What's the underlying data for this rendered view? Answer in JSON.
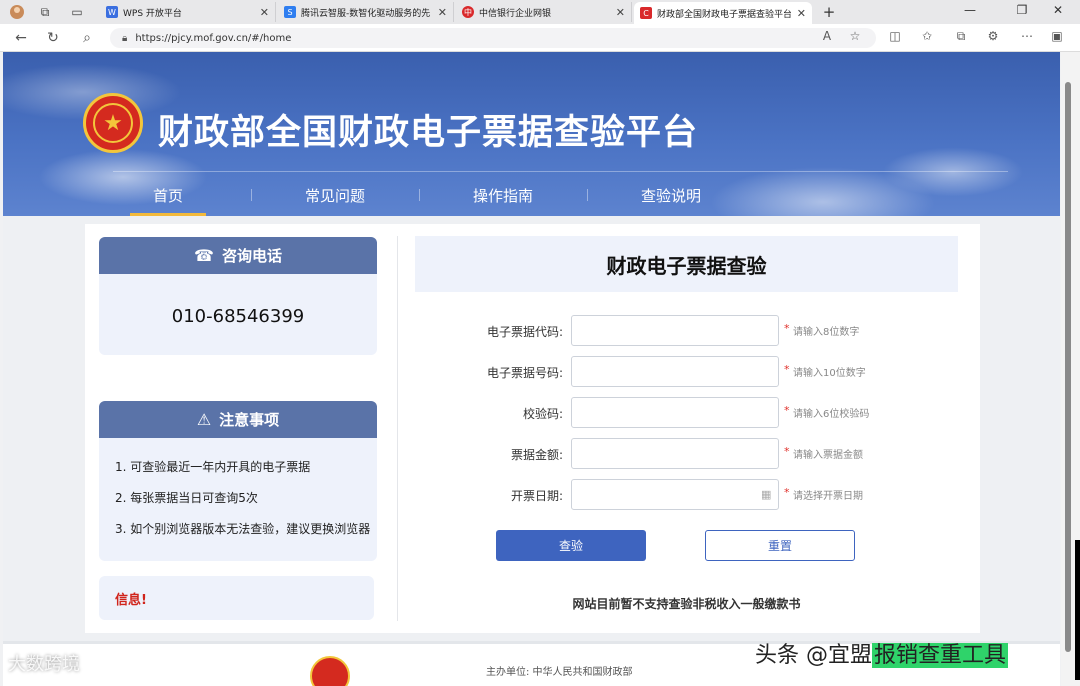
{
  "browser": {
    "tabs": [
      {
        "title": "WPS 开放平台",
        "color": "#3b6fe0",
        "glyph": "W"
      },
      {
        "title": "腾讯云智服-数智化驱动服务的先",
        "color": "#2f7ef0",
        "glyph": "S"
      },
      {
        "title": "中信银行企业网银",
        "color": "#d9292b",
        "glyph": "中"
      },
      {
        "title": "财政部全国财政电子票据查验平台",
        "color": "#d9292b",
        "glyph": "C",
        "active": true
      }
    ],
    "url": "https://pjcy.mof.gov.cn/#/home",
    "icons": [
      "back-icon",
      "refresh-icon",
      "search-icon",
      "lock-icon",
      "read-aloud-icon",
      "favorite-icon",
      "split-icon",
      "favorites-icon",
      "collections-icon",
      "extensions-icon",
      "more-icon",
      "sidebar-icon"
    ]
  },
  "site": {
    "title": "财政部全国财政电子票据查验平台",
    "nav": [
      {
        "label": "首页",
        "active": true
      },
      {
        "label": "常见问题"
      },
      {
        "label": "操作指南"
      },
      {
        "label": "查验说明"
      }
    ]
  },
  "consult": {
    "heading": "咨询电话",
    "phone": "010-68546399"
  },
  "notice": {
    "heading": "注意事项",
    "items": [
      "1. 可查验最近一年内开具的电子票据",
      "2. 每张票据当日可查询5次",
      "3. 如个别浏览器版本无法查验，建议更换浏览器"
    ]
  },
  "info": {
    "label": "信息!"
  },
  "form": {
    "title": "财政电子票据查验",
    "fields": [
      {
        "label": "电子票据代码:",
        "hint": "请输入8位数字",
        "value": ""
      },
      {
        "label": "电子票据号码:",
        "hint": "请输入10位数字",
        "value": ""
      },
      {
        "label": "校验码:",
        "hint": "请输入6位校验码",
        "value": ""
      },
      {
        "label": "票据金额:",
        "hint": "请输入票据金额",
        "value": ""
      },
      {
        "label": "开票日期:",
        "hint": "请选择开票日期",
        "value": ""
      }
    ],
    "required_mark": "*",
    "submit_label": "查验",
    "reset_label": "重置",
    "note": "网站目前暂不支持查验非税收入一般缴款书"
  },
  "footer": {
    "sponsor": "主办单位: 中华人民共和国财政部"
  },
  "watermarks": {
    "left": "大数跨境",
    "right_prefix": "头条 @宜盟",
    "right_highlight": "报销查重工具"
  },
  "colors": {
    "brand_blue": "#3e64bf",
    "banner_blue": "#4b73c4",
    "card_header": "#5a73a8",
    "alert_red": "#d0241b",
    "nav_underline": "#f2b93b"
  }
}
